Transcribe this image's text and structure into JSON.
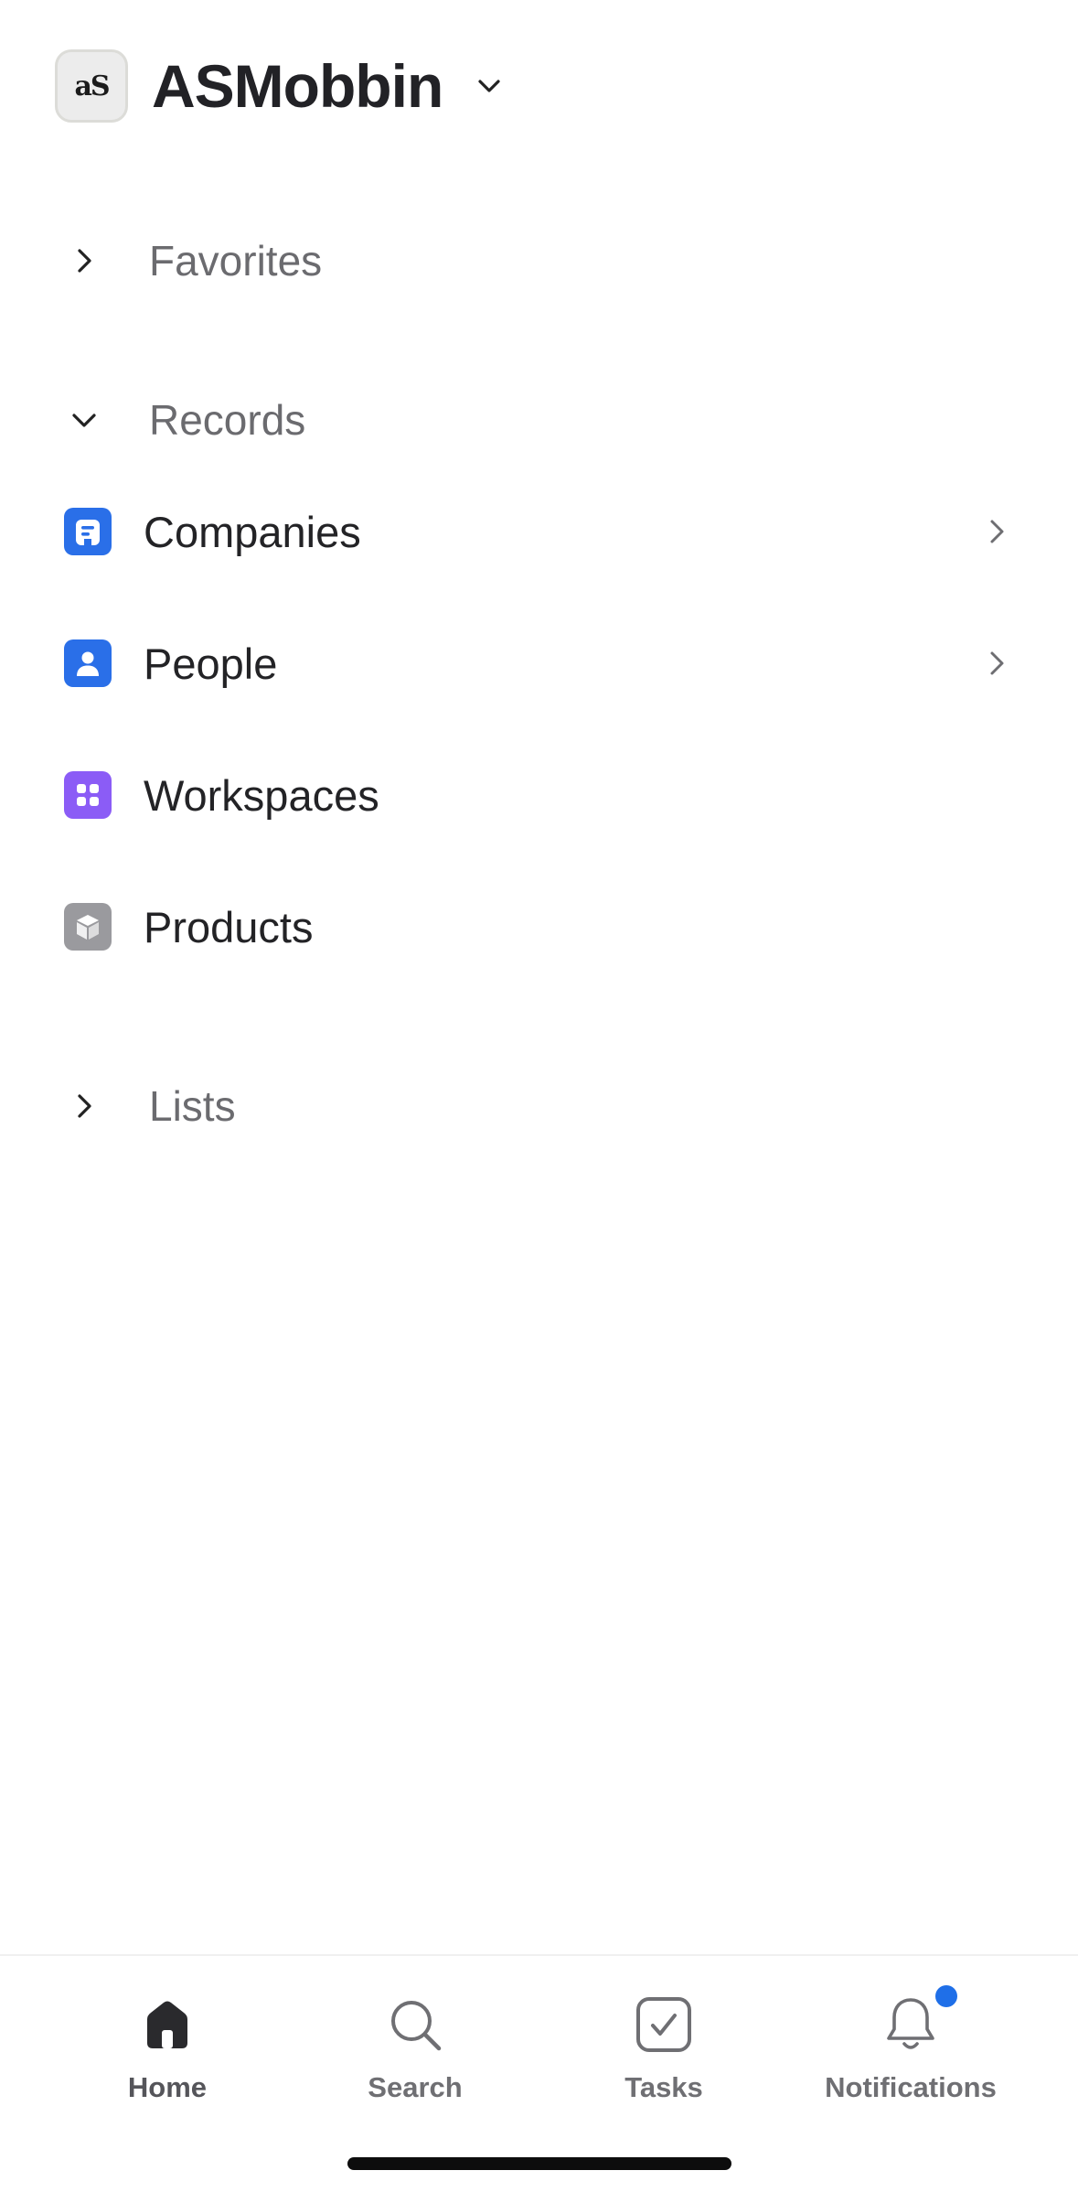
{
  "workspace": {
    "logo_text": "aS",
    "name": "ASMobbin"
  },
  "sections": {
    "favorites": {
      "label": "Favorites",
      "expanded": false
    },
    "records": {
      "label": "Records",
      "expanded": true
    },
    "lists": {
      "label": "Lists",
      "expanded": false
    }
  },
  "records": [
    {
      "label": "Companies",
      "icon": "building-icon",
      "color": "#2a6fe8",
      "has_chevron": true
    },
    {
      "label": "People",
      "icon": "person-icon",
      "color": "#2a6fe8",
      "has_chevron": true
    },
    {
      "label": "Workspaces",
      "icon": "grid-icon",
      "color": "#8b5cf6",
      "has_chevron": false
    },
    {
      "label": "Products",
      "icon": "cube-icon",
      "color": "#9a9a9e",
      "has_chevron": false
    }
  ],
  "tabbar": {
    "home": {
      "label": "Home",
      "icon": "home-icon"
    },
    "search": {
      "label": "Search",
      "icon": "search-icon"
    },
    "tasks": {
      "label": "Tasks",
      "icon": "checkbox-icon"
    },
    "notifications": {
      "label": "Notifications",
      "icon": "bell-icon",
      "has_badge": true,
      "badge_color": "#1f6fe8"
    }
  }
}
